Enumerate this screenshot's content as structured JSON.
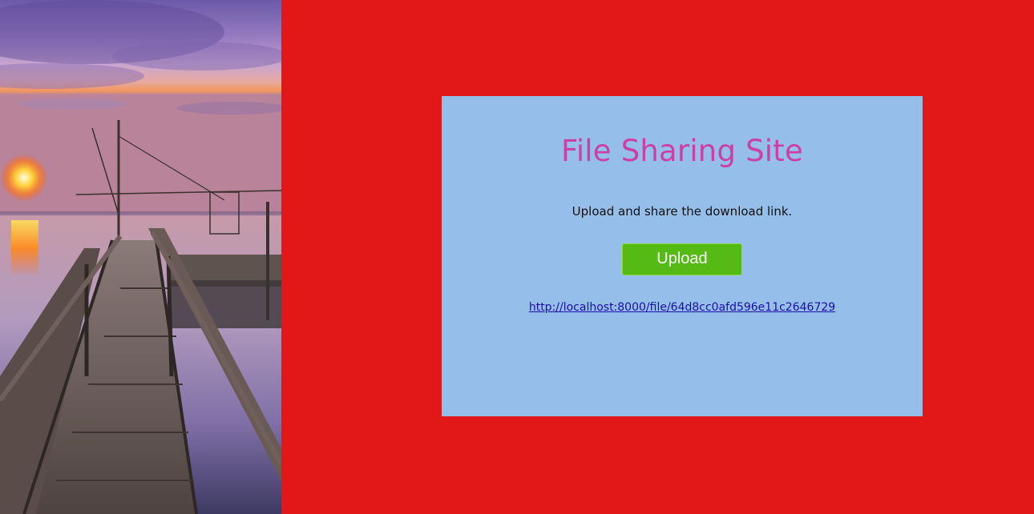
{
  "hero_image": {
    "subject": "sunset over lake with wooden pier"
  },
  "card": {
    "title": "File Sharing Site",
    "subtitle": "Upload and share the download link.",
    "upload_label": "Upload",
    "download_link": "http://localhost:8000/file/64d8cc0afd596e11c2646729"
  },
  "colors": {
    "page_background": "#e21818",
    "card_background": "#95bfea",
    "title": "#cc3fa4",
    "button": "#55bb14",
    "link": "#1a0dab"
  }
}
